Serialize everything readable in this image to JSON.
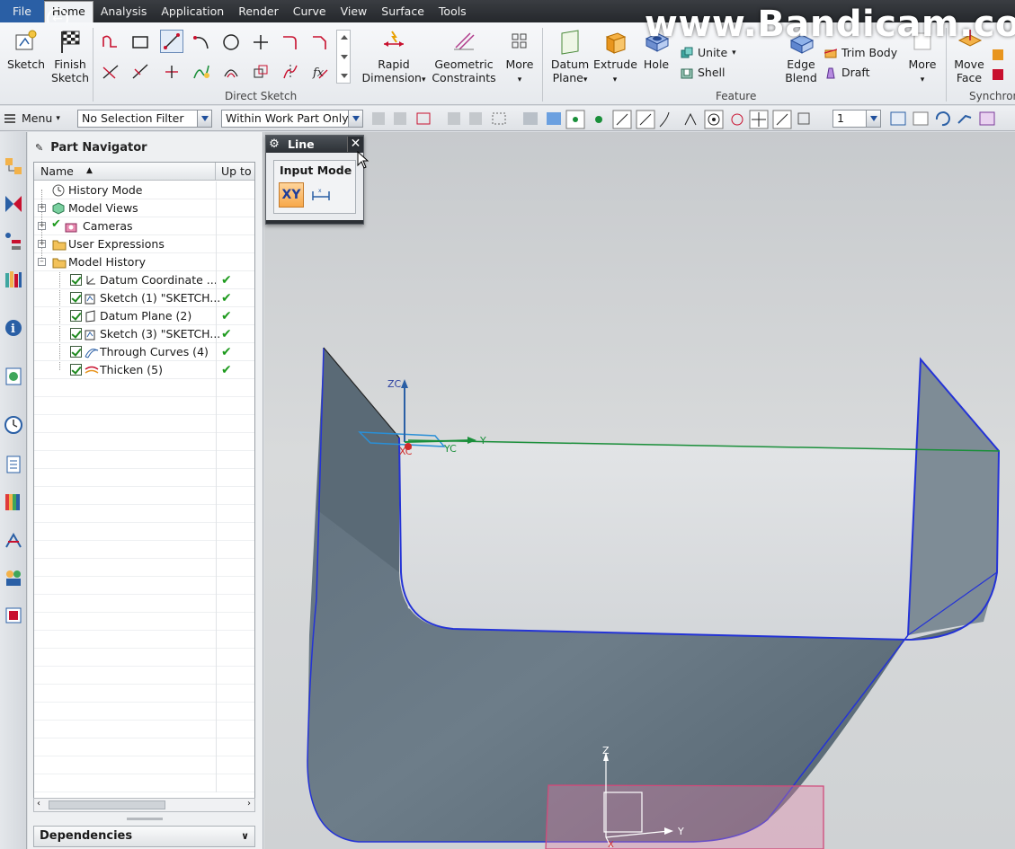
{
  "menu": [
    "File",
    "Home",
    "Analysis",
    "Application",
    "Render",
    "Curve",
    "View",
    "Surface",
    "Tools"
  ],
  "menu_active": "Home",
  "watermark": "www.Bandicam.co",
  "ribbon": {
    "sketch": "Sketch",
    "finish_sketch_1": "Finish",
    "finish_sketch_2": "Sketch",
    "direct_sketch_group": "Direct Sketch",
    "rapid_1": "Rapid",
    "rapid_2": "Dimension",
    "geo_1": "Geometric",
    "geo_2": "Constraints",
    "more1": "More",
    "datum_1": "Datum",
    "datum_2": "Plane",
    "extrude": "Extrude",
    "hole": "Hole",
    "unite": "Unite",
    "shell": "Shell",
    "trim_body": "Trim Body",
    "draft": "Draft",
    "edge_1": "Edge",
    "edge_2": "Blend",
    "more2": "More",
    "feature_group": "Feature",
    "move_1": "Move",
    "move_2": "Face",
    "synchro_group": "Synchron"
  },
  "toolbar": {
    "menu": "Menu",
    "selection_filter": "No Selection Filter",
    "scope": "Within Work Part Only",
    "layer": "1"
  },
  "navigator": {
    "title": "Part Navigator",
    "col_name": "Name",
    "col_upto": "Up to",
    "rows": [
      {
        "label": "History Mode"
      },
      {
        "label": "Model Views"
      },
      {
        "label": "Cameras"
      },
      {
        "label": "User Expressions"
      },
      {
        "label": "Model History"
      },
      {
        "label": "Datum Coordinate ..."
      },
      {
        "label": "Sketch (1) \"SKETCH..."
      },
      {
        "label": "Datum Plane (2)"
      },
      {
        "label": "Sketch (3) \"SKETCH..."
      },
      {
        "label": "Through Curves (4)"
      },
      {
        "label": "Thicken (5)"
      }
    ],
    "dependencies": "Dependencies"
  },
  "dialog": {
    "title": "Line",
    "section": "Input Mode",
    "xy": "XY"
  },
  "viewport": {
    "zc": "ZC",
    "yc_axis": "Y",
    "yc": "YC",
    "xc": "XC",
    "z": "Z",
    "y": "Y",
    "x": "X"
  },
  "colors": {
    "menubar": "#2a2d31",
    "accent": "#2a5fa5",
    "edge": "#2433d6",
    "axis_green": "#1a8f3a",
    "datum_pink": "#d04a7a"
  }
}
